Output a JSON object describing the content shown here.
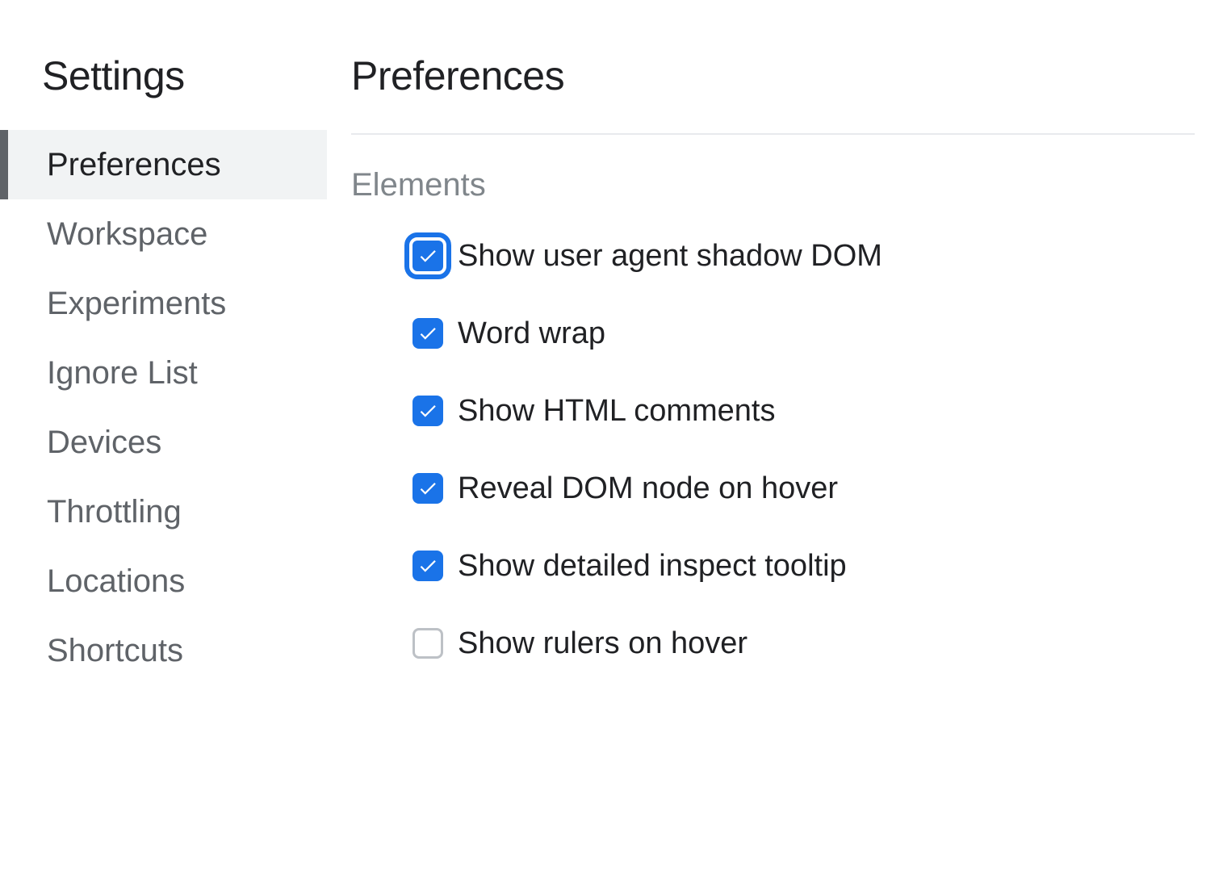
{
  "sidebar": {
    "title": "Settings",
    "items": [
      {
        "label": "Preferences",
        "active": true
      },
      {
        "label": "Workspace",
        "active": false
      },
      {
        "label": "Experiments",
        "active": false
      },
      {
        "label": "Ignore List",
        "active": false
      },
      {
        "label": "Devices",
        "active": false
      },
      {
        "label": "Throttling",
        "active": false
      },
      {
        "label": "Locations",
        "active": false
      },
      {
        "label": "Shortcuts",
        "active": false
      }
    ]
  },
  "main": {
    "title": "Preferences",
    "section": {
      "title": "Elements",
      "options": [
        {
          "label": "Show user agent shadow DOM",
          "checked": true,
          "focused": true
        },
        {
          "label": "Word wrap",
          "checked": true,
          "focused": false
        },
        {
          "label": "Show HTML comments",
          "checked": true,
          "focused": false
        },
        {
          "label": "Reveal DOM node on hover",
          "checked": true,
          "focused": false
        },
        {
          "label": "Show detailed inspect tooltip",
          "checked": true,
          "focused": false
        },
        {
          "label": "Show rulers on hover",
          "checked": false,
          "focused": false
        }
      ]
    }
  }
}
